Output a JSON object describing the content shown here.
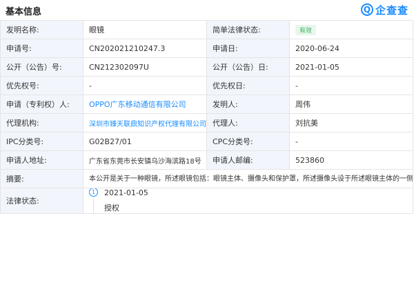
{
  "header": {
    "title": "基本信息",
    "brand": "企查查",
    "brand_icon": "qcc-logo-icon",
    "brand_color": "#1a8cff"
  },
  "rows": {
    "invention_name": {
      "label": "发明名称:",
      "value": "眼镜"
    },
    "legal_status_brief": {
      "label": "简单法律状态:",
      "value": "有效"
    },
    "application_no": {
      "label": "申请号:",
      "value": "CN202021210247.3"
    },
    "application_date": {
      "label": "申请日:",
      "value": "2020-06-24"
    },
    "publication_no": {
      "label": "公开（公告）号:",
      "value": "CN212302097U"
    },
    "publication_date": {
      "label": "公开（公告）日:",
      "value": "2021-01-05"
    },
    "priority_no": {
      "label": "优先权号:",
      "value": "-"
    },
    "priority_date": {
      "label": "优先权日:",
      "value": "-"
    },
    "applicant": {
      "label": "申请（专利权）人:",
      "value": "OPPO广东移动通信有限公司"
    },
    "inventor": {
      "label": "发明人:",
      "value": "周伟"
    },
    "agency": {
      "label": "代理机构:",
      "value": "深圳市臻天联鼎知识产权代理有限公司"
    },
    "agent": {
      "label": "代理人:",
      "value": "刘抗美"
    },
    "ipc": {
      "label": "IPC分类号:",
      "value": "G02B27/01"
    },
    "cpc": {
      "label": "CPC分类号:",
      "value": "-"
    },
    "applicant_address": {
      "label": "申请人地址:",
      "value": "广东省东莞市长安镇乌沙海滨路18号"
    },
    "applicant_zip": {
      "label": "申请人邮编:",
      "value": "523860"
    },
    "abstract": {
      "label": "摘要:",
      "value": "本公开是关于一种眼镜，所述眼镜包括：眼镜主体、摄像头和保护罩，所述摄像头设于所述眼镜主体的一侧；所述保护罩设于所述眼镜主体并覆盖所述摄像头，所述保护罩包括和所述摄像头相对的摄像保护区，所述摄像保护区具有反射层，所述反射层的反射率大于等于第一预设阈值，并且所述反射层的反射率小于等于第二预设阈值，以使所述保护罩远离所述眼镜主体一侧的部分光线能够通过所述反射层，并使保护罩远离眼镜主体一侧的部分光线被所述反射层反射。能够在视觉上隐藏摄像头，提升眼镜表面的一致性。"
    },
    "legal_status": {
      "label": "法律状态:",
      "step": "1",
      "date": "2021-01-05",
      "event": "授权"
    }
  },
  "colors": {
    "label_bg": "#f2f6fc",
    "link": "#1a8cff",
    "badge_bg": "#e8f6ec",
    "badge_text": "#3fb25e"
  }
}
